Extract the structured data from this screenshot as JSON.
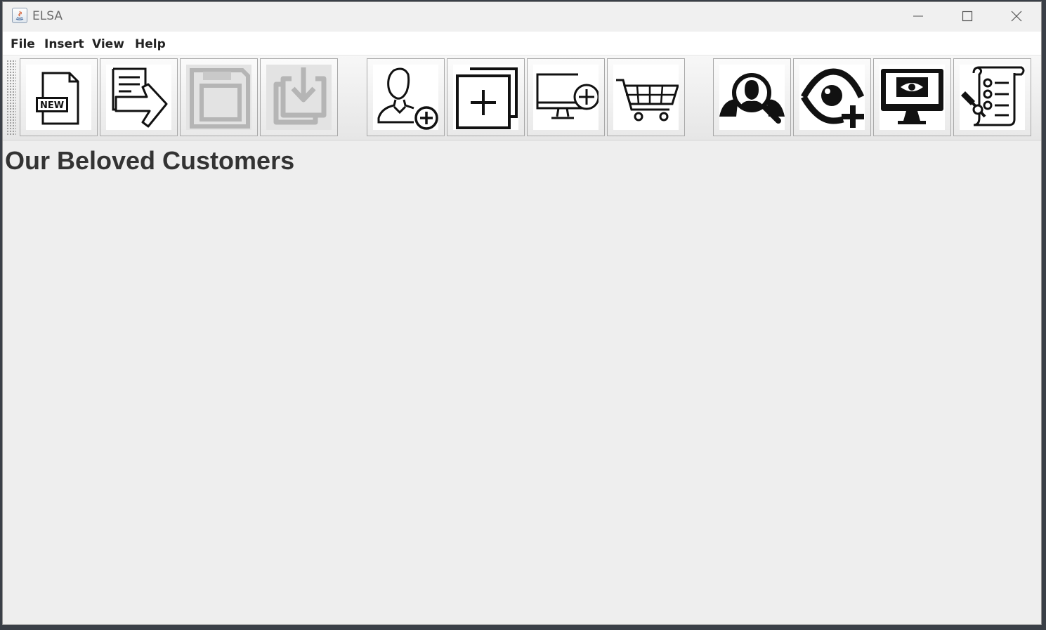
{
  "window": {
    "title": "ELSA",
    "minimize_icon": "minimize-icon",
    "maximize_icon": "maximize-icon",
    "close_icon": "close-icon"
  },
  "menubar": {
    "items": [
      {
        "label": "File"
      },
      {
        "label": "Insert"
      },
      {
        "label": "View"
      },
      {
        "label": "Help"
      }
    ]
  },
  "toolbar": {
    "buttons": [
      {
        "icon": "new-document-icon",
        "enabled": true
      },
      {
        "icon": "open-document-icon",
        "enabled": true
      },
      {
        "icon": "save-icon",
        "enabled": false
      },
      {
        "icon": "import-icon",
        "enabled": false
      },
      {
        "icon": "add-customer-icon",
        "enabled": true
      },
      {
        "icon": "add-item-icon",
        "enabled": true
      },
      {
        "icon": "add-device-icon",
        "enabled": true
      },
      {
        "icon": "shopping-cart-icon",
        "enabled": true
      },
      {
        "icon": "search-customer-icon",
        "enabled": true
      },
      {
        "icon": "add-view-icon",
        "enabled": true
      },
      {
        "icon": "monitor-view-icon",
        "enabled": true
      },
      {
        "icon": "checklist-icon",
        "enabled": true
      }
    ]
  },
  "main": {
    "heading": "Our Beloved Customers"
  }
}
